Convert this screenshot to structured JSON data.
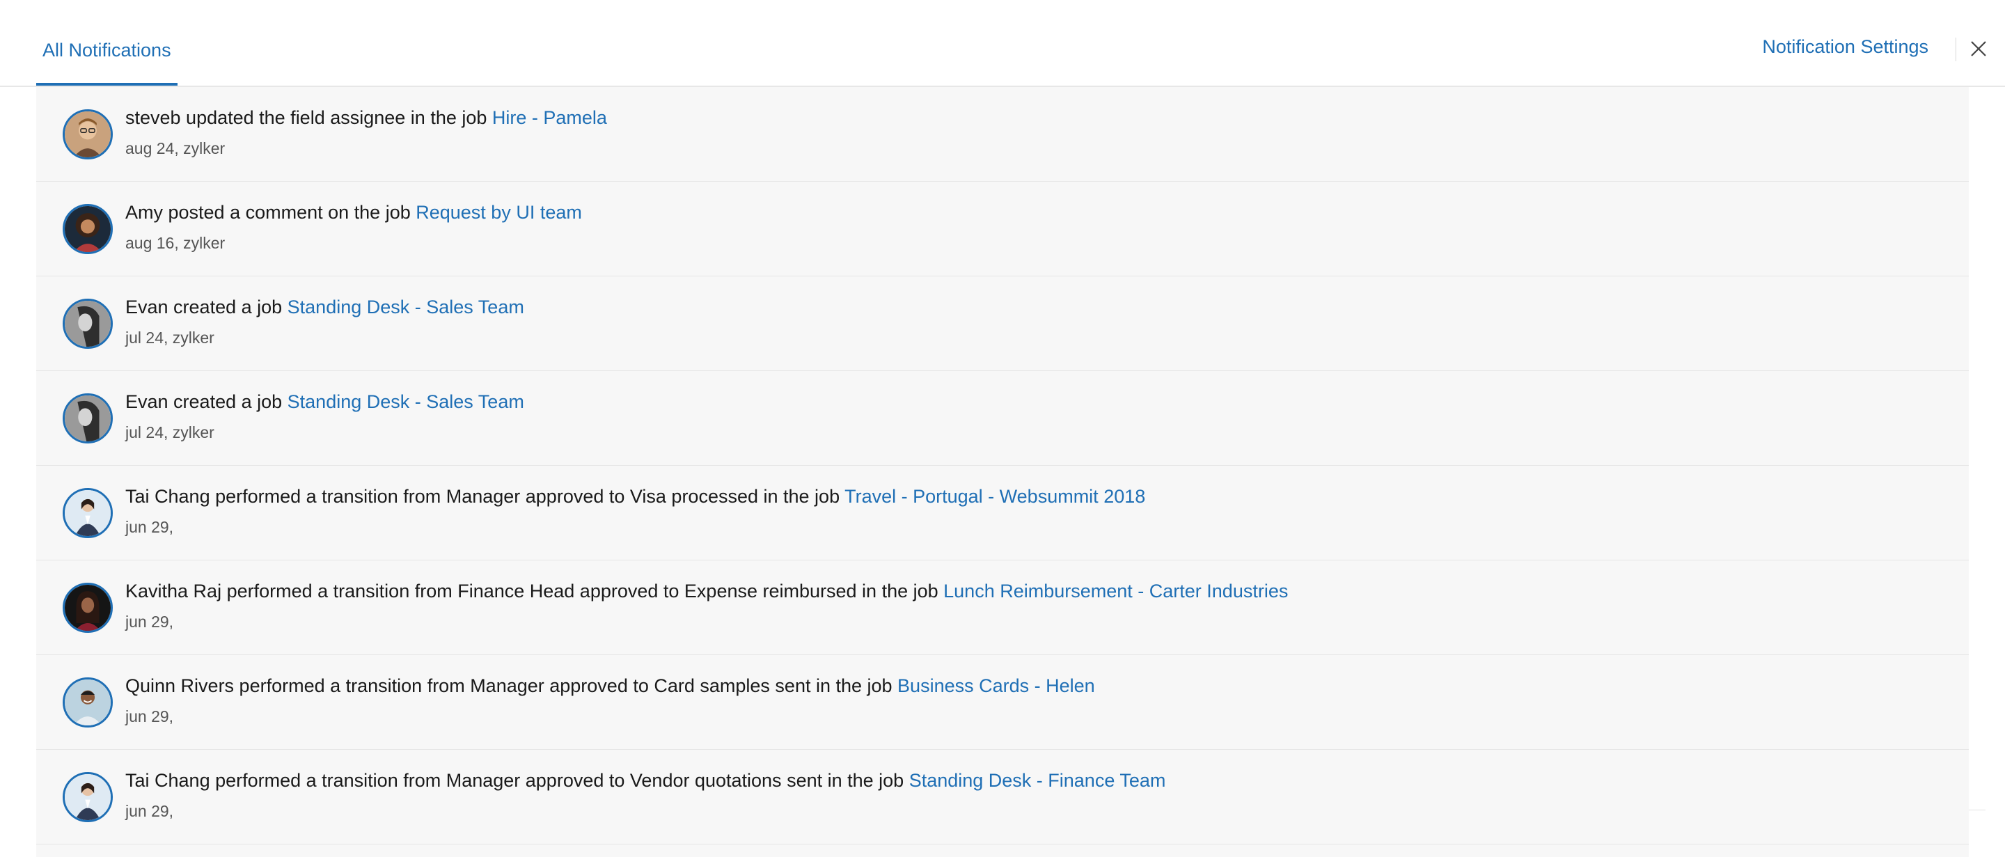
{
  "header": {
    "tab_label": "All Notifications",
    "settings_label": "Notification Settings"
  },
  "colors": {
    "accent": "#1f6fb5",
    "list_background": "#f7f7f7",
    "text": "#1a1a1a",
    "meta_text": "#555555"
  },
  "notifications": [
    {
      "text": "steveb updated the field assignee in the job ",
      "link": "Hire - Pamela",
      "meta": "aug 24, zylker",
      "avatar_icon": "man-glasses-avatar"
    },
    {
      "text": "Amy posted a comment on the job ",
      "link": "Request by UI team",
      "meta": "aug 16, zylker",
      "avatar_icon": "woman-curly-hair-avatar"
    },
    {
      "text": "Evan created a job ",
      "link": "Standing Desk - Sales Team",
      "meta": "jul 24, zylker",
      "avatar_icon": "woman-monochrome-avatar"
    },
    {
      "text": "Evan created a job ",
      "link": "Standing Desk - Sales Team",
      "meta": "jul 24, zylker",
      "avatar_icon": "woman-monochrome-avatar"
    },
    {
      "text": "Tai Chang performed a transition from Manager approved to Visa processed in the job ",
      "link": "Travel - Portugal - Websummit 2018",
      "meta": "jun 29,",
      "avatar_icon": "woman-business-avatar"
    },
    {
      "text": "Kavitha Raj performed a transition from Finance Head approved to Expense reimbursed in the job ",
      "link": "Lunch Reimbursement - Carter Industries",
      "meta": "jun 29,",
      "avatar_icon": "woman-dark-hair-avatar"
    },
    {
      "text": "Quinn Rivers performed a transition from Manager approved to Card samples sent in the job ",
      "link": "Business Cards - Helen",
      "meta": "jun 29,",
      "avatar_icon": "man-smiling-avatar"
    },
    {
      "text": "Tai Chang performed a transition from Manager approved to Vendor quotations sent in the job ",
      "link": "Standing Desk - Finance Team",
      "meta": "jun 29,",
      "avatar_icon": "woman-business-avatar"
    }
  ]
}
